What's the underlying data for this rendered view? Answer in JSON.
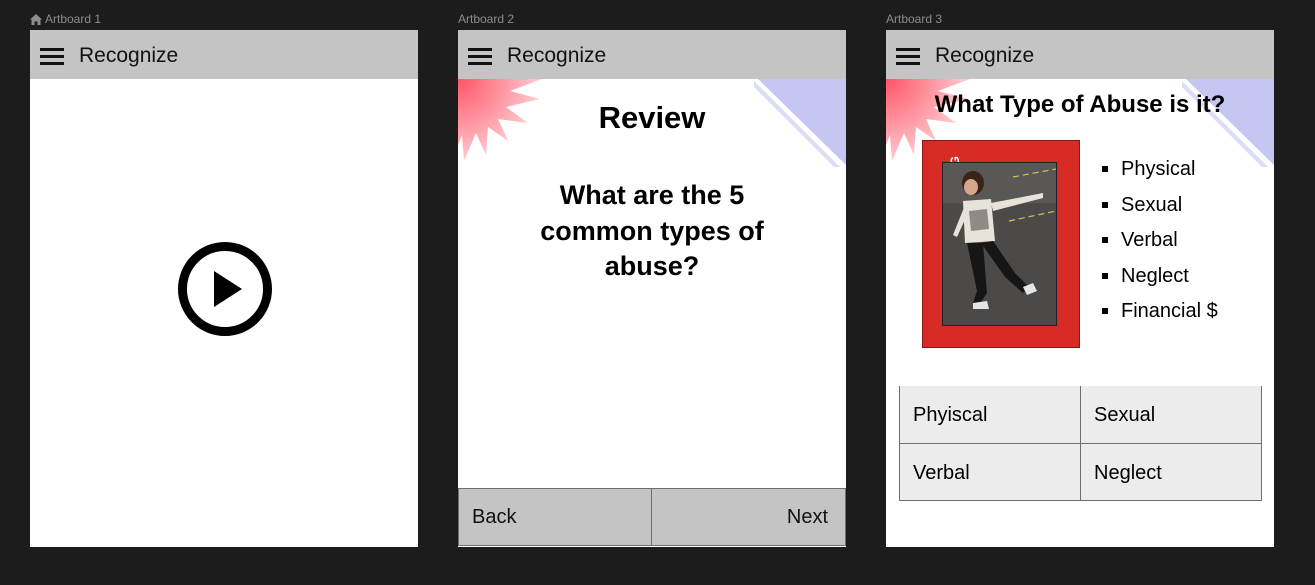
{
  "artboards": [
    {
      "label": "Artboard 1",
      "header": {
        "title": "Recognize"
      }
    },
    {
      "label": "Artboard 2",
      "header": {
        "title": "Recognize"
      },
      "heading": "Review",
      "question": "What are the 5 common types of abuse?",
      "back_label": "Back",
      "next_label": "Next"
    },
    {
      "label": "Artboard 3",
      "header": {
        "title": "Recognize"
      },
      "heading": "What Type of Abuse is it?",
      "card_label": "KICKING",
      "types": [
        "Physical",
        "Sexual",
        "Verbal",
        "Neglect",
        "Financial $"
      ],
      "answers": [
        "Phyiscal",
        "Sexual",
        "Verbal",
        "Neglect"
      ]
    }
  ],
  "colors": {
    "canvas": "#1b1c1b",
    "header": "#c4c4c4",
    "card_red": "#d92b26",
    "answer_bg": "#ececec",
    "burst_pink": "#ffb3bb",
    "stripe_blue": "#c6c6f2"
  },
  "icons": {
    "home": "home-icon",
    "menu": "hamburger-menu-icon",
    "play": "play-circle-icon"
  }
}
